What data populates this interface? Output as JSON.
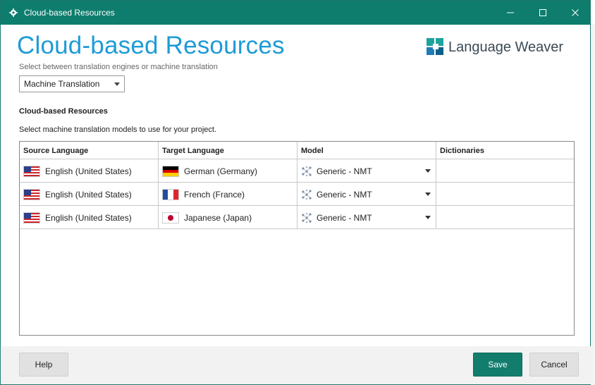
{
  "window": {
    "title": "Cloud-based Resources"
  },
  "header": {
    "heading": "Cloud-based Resources",
    "subheading": "Select between translation engines or machine translation",
    "logo_text": "Language Weaver"
  },
  "mode_select": {
    "value": "Machine Translation"
  },
  "section": {
    "title": "Cloud-based Resources",
    "description": "Select machine translation models to use for your project."
  },
  "grid": {
    "columns": [
      "Source Language",
      "Target Language",
      "Model",
      "Dictionaries"
    ],
    "rows": [
      {
        "source": "English (United States)",
        "source_flag": "us-flag",
        "target": "German (Germany)",
        "target_flag": "de-flag",
        "model": "Generic - NMT",
        "dictionaries": ""
      },
      {
        "source": "English (United States)",
        "source_flag": "us-flag",
        "target": "French (France)",
        "target_flag": "fr-flag",
        "model": "Generic - NMT",
        "dictionaries": ""
      },
      {
        "source": "English (United States)",
        "source_flag": "us-flag",
        "target": "Japanese (Japan)",
        "target_flag": "jp-flag",
        "model": "Generic - NMT",
        "dictionaries": ""
      }
    ]
  },
  "footer": {
    "help_label": "Help",
    "save_label": "Save",
    "cancel_label": "Cancel"
  },
  "colors": {
    "titlebar": "#0e7d6e",
    "heading": "#1e9bd7",
    "save_button": "#127d6d"
  }
}
